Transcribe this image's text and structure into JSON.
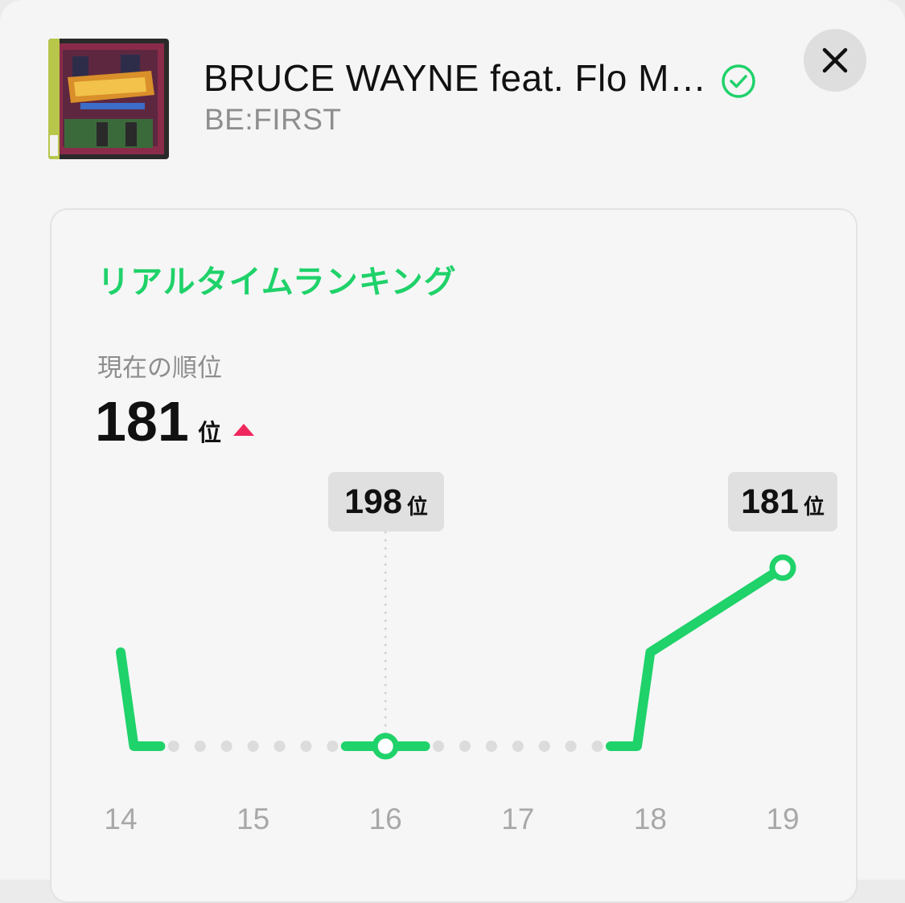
{
  "track": {
    "title": "BRUCE WAYNE feat. Flo Mill...",
    "artist": "BE:FIRST",
    "artwork_icon": "album-artwork-image"
  },
  "header": {
    "close_icon": "close-icon",
    "verified_icon": "check-circle-icon"
  },
  "ranking": {
    "section_title": "リアルタイムランキング",
    "current_label": "現在の順位",
    "current_value": "181",
    "unit": "位",
    "trend": "up"
  },
  "tooltips": [
    {
      "value": "198",
      "unit": "位"
    },
    {
      "value": "181",
      "unit": "位"
    }
  ],
  "chart_data": {
    "type": "line",
    "x_ticks": [
      "14",
      "15",
      "16",
      "17",
      "18",
      "19"
    ],
    "series": [
      {
        "values": [
          {
            "x": 14.0,
            "y": 190
          },
          {
            "x": 14.1,
            "y": 200
          },
          {
            "x": 14.3,
            "y": 200
          },
          {
            "x": 15.7,
            "y": 200
          },
          {
            "x": 16.3,
            "y": 200
          },
          {
            "x": 17.7,
            "y": 200
          },
          {
            "x": 17.9,
            "y": 200
          },
          {
            "x": 18.0,
            "y": 190
          },
          {
            "x": 19.0,
            "y": 181
          }
        ]
      }
    ],
    "gaps": [
      [
        14.3,
        15.7
      ],
      [
        16.3,
        17.7
      ]
    ],
    "highlighted_points": [
      {
        "x": 16,
        "y": 198
      },
      {
        "x": 19,
        "y": 181
      }
    ],
    "ylim": [
      181,
      200
    ],
    "y_inverted": true,
    "line_color": "#1fd26a",
    "gap_dot_color": "#dcdcdc"
  },
  "colors": {
    "accent": "#1fd26a",
    "trend_up": "#f0275e"
  }
}
